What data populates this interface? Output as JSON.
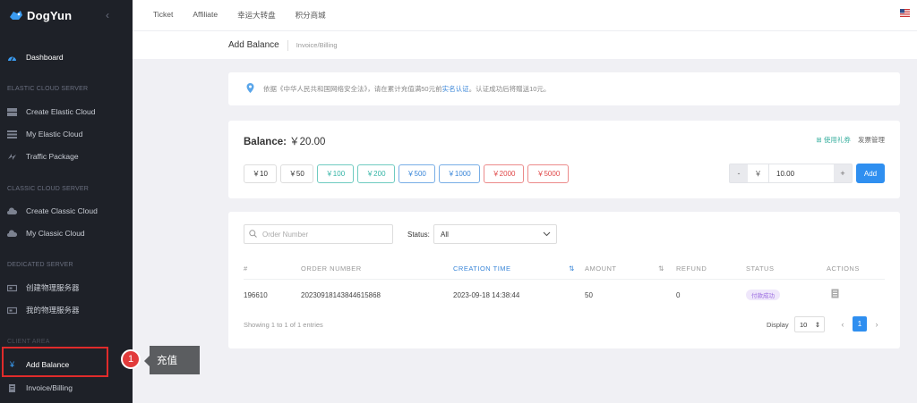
{
  "app": {
    "brand": "DogYun"
  },
  "colors": {
    "accent": "#2f8ff0",
    "sidebar_bg": "#1e2128",
    "highlight": "#e02b2b"
  },
  "sidebar": {
    "dashboard": "Dashboard",
    "section_elastic": "ELASTIC CLOUD SERVER",
    "create_elastic": "Create Elastic Cloud",
    "my_elastic": "My Elastic Cloud",
    "traffic": "Traffic Package",
    "section_classic": "CLASSIC CLOUD SERVER",
    "create_classic": "Create Classic Cloud",
    "my_classic": "My Classic Cloud",
    "section_dedicated": "DEDICATED SERVER",
    "create_physical": "创建物理服务器",
    "my_physical": "我的物理服务器",
    "section_client": "CLIENT AREA",
    "add_balance": "Add Balance",
    "invoice": "Invoice/Billing"
  },
  "topnav": {
    "ticket": "Ticket",
    "affiliate": "Affiliate",
    "lucky": "幸运大转盘",
    "points": "积分商城"
  },
  "page": {
    "title": "Add Balance",
    "breadcrumb": "Invoice/Billing"
  },
  "notice": {
    "prefix": "依据《中华人民共和国网络安全法》，请在累计充值满50元前",
    "link": "实名认证",
    "suffix": "。认证成功后将赠送10元。"
  },
  "balance": {
    "label": "Balance:",
    "amount": "￥20.00",
    "gift_link": "使用礼券",
    "invoice_link": "发票管理",
    "chips": [
      "￥10",
      "￥50",
      "￥100",
      "￥200",
      "￥500",
      "￥1000",
      "￥2000",
      "￥5000"
    ],
    "stepper": {
      "minus": "-",
      "currency": "￥",
      "value": "10.00",
      "plus": "+"
    },
    "add_label": "Add"
  },
  "orders": {
    "search_placeholder": "Order Number",
    "status_label": "Status:",
    "status_value": "All",
    "columns": [
      "#",
      "ORDER NUMBER",
      "CREATION TIME",
      "AMOUNT",
      "REFUND",
      "STATUS",
      "ACTIONS"
    ],
    "rows": [
      {
        "id": "196610",
        "order": "20230918143844615868",
        "time": "2023-09-18 14:38:44",
        "amount": "50",
        "refund": "0",
        "status": "付款成功"
      }
    ],
    "showing": "Showing 1 to 1 of 1 entries",
    "display_label": "Display",
    "display_value": "10",
    "page_current": "1"
  },
  "annotation": {
    "number": "1",
    "tooltip": "充值"
  }
}
